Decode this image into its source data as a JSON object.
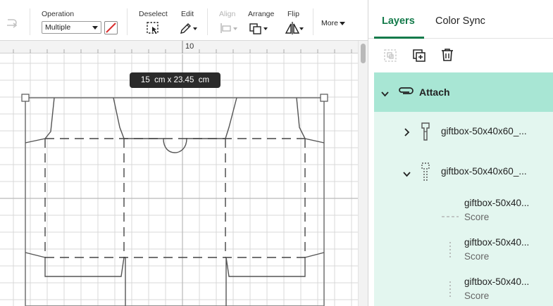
{
  "toolbar": {
    "operation_label": "Operation",
    "operation_value": "Multiple",
    "deselect_label": "Deselect",
    "edit_label": "Edit",
    "align_label": "Align",
    "arrange_label": "Arrange",
    "flip_label": "Flip",
    "more_label": "More",
    "accent": "#137a4a"
  },
  "canvas": {
    "ruler_mark": "10",
    "dimension_tooltip": "15  cm x 23.45  cm"
  },
  "panel": {
    "tabs": [
      {
        "label": "Layers",
        "active": true
      },
      {
        "label": "Color Sync",
        "active": false
      }
    ],
    "group": {
      "label": "Attach",
      "icon": "paperclip-icon",
      "color": "#a8e6d4"
    },
    "layers": [
      {
        "name": "giftbox-50x40x60_...",
        "icon": "cut-icon",
        "expanded": false
      },
      {
        "name": "giftbox-50x40x60_...",
        "icon": "score-group-icon",
        "expanded": true
      },
      {
        "name": "giftbox-50x40...",
        "type": "Score",
        "icon": "dashed-line-icon"
      },
      {
        "name": "giftbox-50x40...",
        "type": "Score",
        "icon": "dotted-line-icon"
      },
      {
        "name": "giftbox-50x40...",
        "type": "Score",
        "icon": "dotted-line-icon"
      }
    ]
  }
}
